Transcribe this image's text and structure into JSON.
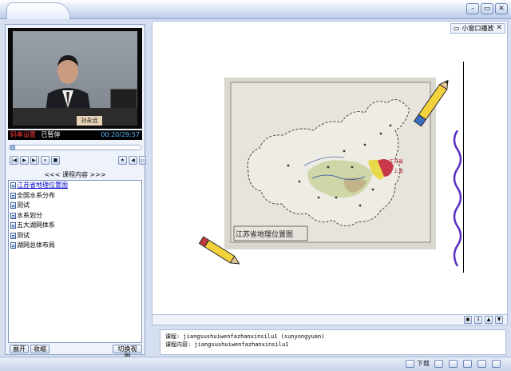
{
  "window": {
    "buttons": [
      "-",
      "▭",
      "✕"
    ]
  },
  "video": {
    "nameplate": "孙永远",
    "status_left": "码率设置",
    "status_pause": "已暂停",
    "time": "00:20/29:57"
  },
  "controls": [
    "|◀",
    "▶",
    "▶|",
    "⏸",
    "■"
  ],
  "course": {
    "header": "<<< 课程内容 >>>",
    "items": [
      {
        "label": "江苏省地理位置图",
        "active": true
      },
      {
        "label": "全国水系分布",
        "active": false
      },
      {
        "label": "测试",
        "active": false
      },
      {
        "label": "水系划分",
        "active": false
      },
      {
        "label": "五大湖网体系",
        "active": false
      },
      {
        "label": "测试",
        "active": false
      },
      {
        "label": "湖网总体布局",
        "active": false
      }
    ]
  },
  "left_buttons": {
    "expand": "展开",
    "collapse": "收缩",
    "switch_view": "切换视图"
  },
  "main": {
    "small_window": "小窗口播放",
    "map_title": "江苏省地理位置图",
    "map_label_jiangsu": "江苏省",
    "map_label_shanghai": "上海"
  },
  "info": {
    "course_line": "课程: jiangsushuiwenfazhanxinsilu1 (sunyongyuan)",
    "content_line": "课程内容: jiangsushuiwenfazhanxinsilu1"
  },
  "status_bar": {
    "download": "下载"
  },
  "colors": {
    "accent": "#8fa3c8",
    "status_red": "#ff3b3b",
    "time_blue": "#58b9ff",
    "jiangsu_red": "#c9384a",
    "map_yellow": "#e9d84a"
  }
}
